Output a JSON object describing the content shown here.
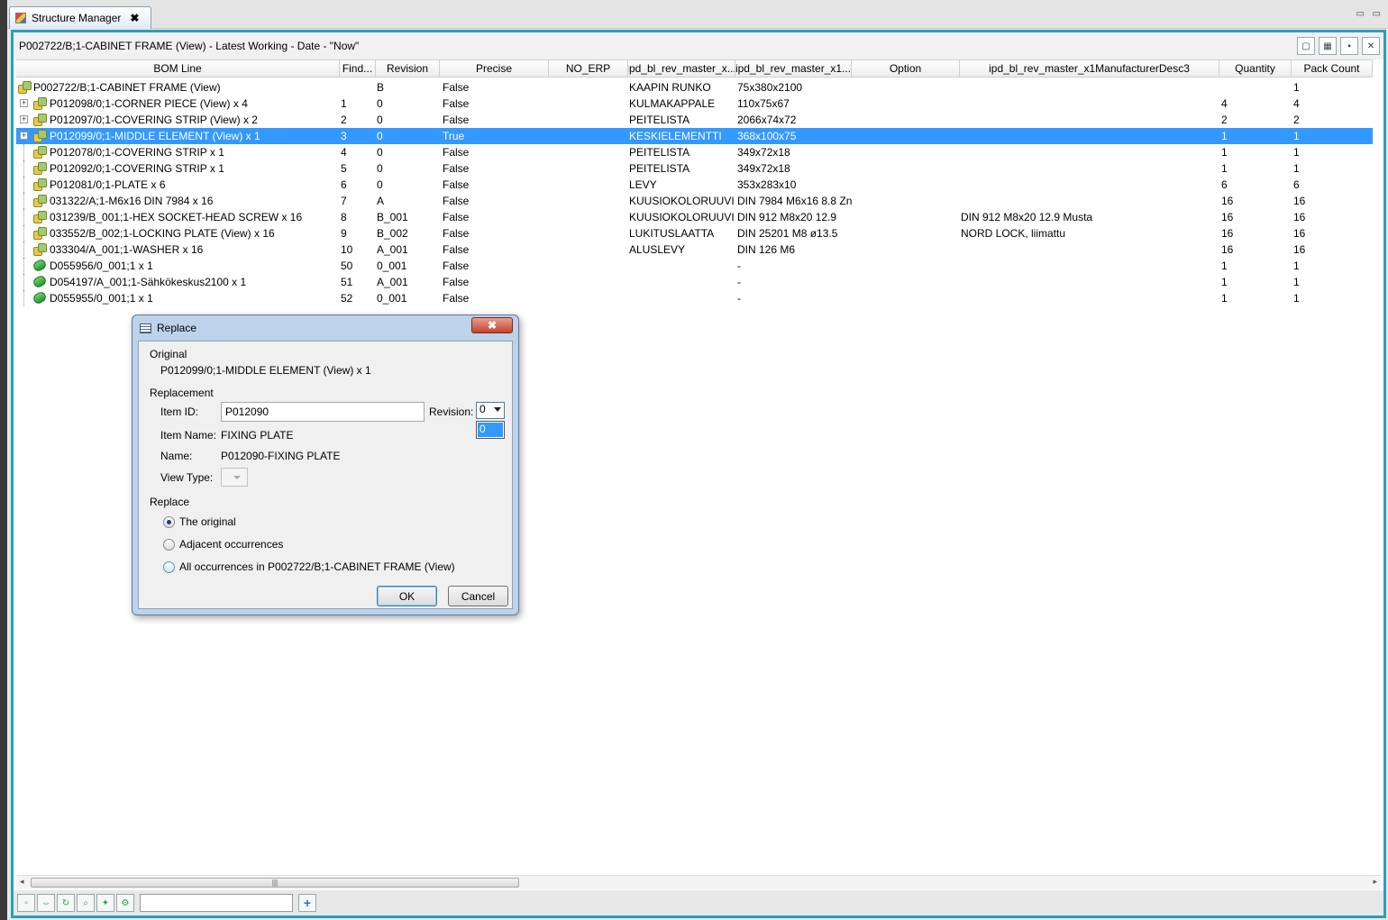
{
  "tab": {
    "label": "Structure Manager",
    "close": "✖"
  },
  "window_controls": {
    "minimize": "▭",
    "maximize": "▭"
  },
  "header": {
    "title": "P002722/B;1-CABINET FRAME (View) - Latest Working - Date - \"Now\""
  },
  "columns": [
    "BOM Line",
    "Find...",
    "Revision",
    "Precise",
    "NO_ERP",
    "ipd_bl_rev_master_x...",
    "ipd_bl_rev_master_x1...",
    "Option",
    "ipd_bl_rev_master_x1ManufacturerDesc3",
    "Quantity",
    "Pack Count"
  ],
  "rows": [
    {
      "bom": "P002722/B;1-CABINET FRAME (View)",
      "find": "",
      "rev": "B",
      "precise": "False",
      "erp": "",
      "desc1": "KAAPIN RUNKO",
      "desc2": "75x380x2100",
      "option": "",
      "mfr": "",
      "qty": "",
      "pack": "1"
    },
    {
      "bom": "P012098/0;1-CORNER PIECE (View) x 4",
      "find": "1",
      "rev": "0",
      "precise": "False",
      "erp": "",
      "desc1": "KULMAKAPPALE",
      "desc2": "110x75x67",
      "option": "",
      "mfr": "",
      "qty": "4",
      "pack": "4"
    },
    {
      "bom": "P012097/0;1-COVERING STRIP (View) x 2",
      "find": "2",
      "rev": "0",
      "precise": "False",
      "erp": "",
      "desc1": "PEITELISTA",
      "desc2": "2066x74x72",
      "option": "",
      "mfr": "",
      "qty": "2",
      "pack": "2"
    },
    {
      "bom": "P012099/0;1-MIDDLE ELEMENT (View) x 1",
      "find": "3",
      "rev": "0",
      "precise": "True",
      "erp": "",
      "desc1": "KESKIELEMENTTI",
      "desc2": "368x100x75",
      "option": "",
      "mfr": "",
      "qty": "1",
      "pack": "1"
    },
    {
      "bom": "P012078/0;1-COVERING STRIP x 1",
      "find": "4",
      "rev": "0",
      "precise": "False",
      "erp": "",
      "desc1": "PEITELISTA",
      "desc2": "349x72x18",
      "option": "",
      "mfr": "",
      "qty": "1",
      "pack": "1"
    },
    {
      "bom": "P012092/0;1-COVERING STRIP x 1",
      "find": "5",
      "rev": "0",
      "precise": "False",
      "erp": "",
      "desc1": "PEITELISTA",
      "desc2": "349x72x18",
      "option": "",
      "mfr": "",
      "qty": "1",
      "pack": "1"
    },
    {
      "bom": "P012081/0;1-PLATE x 6",
      "find": "6",
      "rev": "0",
      "precise": "False",
      "erp": "",
      "desc1": "LEVY",
      "desc2": "353x283x10",
      "option": "",
      "mfr": "",
      "qty": "6",
      "pack": "6"
    },
    {
      "bom": "031322/A;1-M6x16 DIN 7984 x 16",
      "find": "7",
      "rev": "A",
      "precise": "False",
      "erp": "",
      "desc1": "KUUSIOKOLORUUVI",
      "desc2": "DIN 7984 M6x16 8.8 Zn",
      "option": "",
      "mfr": "",
      "qty": "16",
      "pack": "16"
    },
    {
      "bom": "031239/B_001;1-HEX SOCKET-HEAD SCREW x 16",
      "find": "8",
      "rev": "B_001",
      "precise": "False",
      "erp": "",
      "desc1": "KUUSIOKOLORUUVI",
      "desc2": "DIN 912 M8x20 12.9",
      "option": "",
      "mfr": "DIN 912 M8x20 12.9 Musta",
      "qty": "16",
      "pack": "16"
    },
    {
      "bom": "033552/B_002;1-LOCKING PLATE (View) x 16",
      "find": "9",
      "rev": "B_002",
      "precise": "False",
      "erp": "",
      "desc1": "LUKITUSLAATTA",
      "desc2": "DIN 25201 M8 ø13.5",
      "option": "",
      "mfr": "NORD LOCK, liimattu",
      "qty": "16",
      "pack": "16"
    },
    {
      "bom": "033304/A_001;1-WASHER x 16",
      "find": "10",
      "rev": "A_001",
      "precise": "False",
      "erp": "",
      "desc1": "ALUSLEVY",
      "desc2": "DIN 126 M6",
      "option": "",
      "mfr": "",
      "qty": "16",
      "pack": "16"
    },
    {
      "bom": "D055956/0_001;1 x 1",
      "find": "50",
      "rev": "0_001",
      "precise": "False",
      "erp": "",
      "desc1": "",
      "desc2": "-",
      "option": "",
      "mfr": "",
      "qty": "1",
      "pack": "1"
    },
    {
      "bom": "D054197/A_001;1-Sähkökeskus2100 x 1",
      "find": "51",
      "rev": "A_001",
      "precise": "False",
      "erp": "",
      "desc1": "",
      "desc2": "-",
      "option": "",
      "mfr": "",
      "qty": "1",
      "pack": "1"
    },
    {
      "bom": "D055955/0_001;1 x 1",
      "find": "52",
      "rev": "0_001",
      "precise": "False",
      "erp": "",
      "desc1": "",
      "desc2": "-",
      "option": "",
      "mfr": "",
      "qty": "1",
      "pack": "1"
    }
  ],
  "row_meta": [
    {
      "icon": "assembly-icon",
      "expandable": false,
      "depth": 0,
      "selected": false
    },
    {
      "icon": "assembly-icon",
      "expandable": true,
      "depth": 1,
      "selected": false
    },
    {
      "icon": "assembly-icon",
      "expandable": true,
      "depth": 1,
      "selected": false
    },
    {
      "icon": "assembly-icon",
      "expandable": true,
      "depth": 1,
      "selected": true
    },
    {
      "icon": "assembly-icon",
      "expandable": false,
      "depth": 1,
      "selected": false
    },
    {
      "icon": "assembly-icon",
      "expandable": false,
      "depth": 1,
      "selected": false
    },
    {
      "icon": "assembly-icon",
      "expandable": false,
      "depth": 1,
      "selected": false
    },
    {
      "icon": "assembly-icon",
      "expandable": false,
      "depth": 1,
      "selected": false
    },
    {
      "icon": "assembly-icon",
      "expandable": false,
      "depth": 1,
      "selected": false
    },
    {
      "icon": "assembly-icon",
      "expandable": false,
      "depth": 1,
      "selected": false
    },
    {
      "icon": "assembly-icon",
      "expandable": false,
      "depth": 1,
      "selected": false
    },
    {
      "icon": "dataset-icon",
      "expandable": false,
      "depth": 1,
      "selected": false
    },
    {
      "icon": "dataset-icon",
      "expandable": false,
      "depth": 1,
      "selected": false
    },
    {
      "icon": "dataset-icon",
      "expandable": false,
      "depth": 1,
      "selected": false
    }
  ],
  "dialog": {
    "title": "Replace",
    "close": "✖",
    "original_label": "Original",
    "original_value": "P012099/0;1-MIDDLE ELEMENT (View) x 1",
    "replacement_label": "Replacement",
    "item_id_label": "Item ID:",
    "item_id_value": "P012090",
    "revision_label": "Revision:",
    "revision_value": "0",
    "revision_options": [
      "0"
    ],
    "item_name_label": "Item Name:",
    "item_name_value": "FIXING PLATE",
    "name_label": "Name:",
    "name_value": "P012090-FIXING PLATE",
    "view_type_label": "View Type:",
    "replace_label": "Replace",
    "options": [
      {
        "label": "The original",
        "checked": true
      },
      {
        "label": "Adjacent occurrences",
        "checked": false
      },
      {
        "label": "All occurrences in P002722/B;1-CABINET FRAME (View)",
        "checked": false
      }
    ],
    "ok": "OK",
    "cancel": "Cancel"
  },
  "colors": {
    "selection": "#3399ff",
    "panel_border": "#2aa0b8",
    "dialog_frame": "#bcd3ea"
  }
}
